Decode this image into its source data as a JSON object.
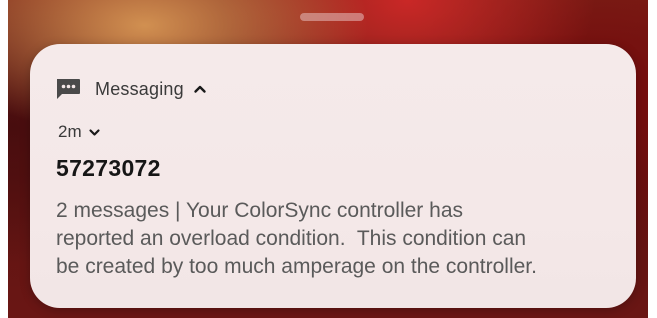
{
  "notification": {
    "app_name": "Messaging",
    "app_icon": "message-icon",
    "expand_icon": "chevron-up-icon",
    "time": "2m",
    "time_icon": "chevron-down-icon",
    "sender": "57273072",
    "body": "2 messages | Your ColorSync controller has\nreported an overload condition.  This condition can\nbe created by too much amperage on the controller."
  },
  "colors": {
    "card_bg": "#f4e8e8",
    "text_primary": "#161616",
    "text_secondary": "#5a5a5a",
    "icon": "#4a4a4a"
  }
}
